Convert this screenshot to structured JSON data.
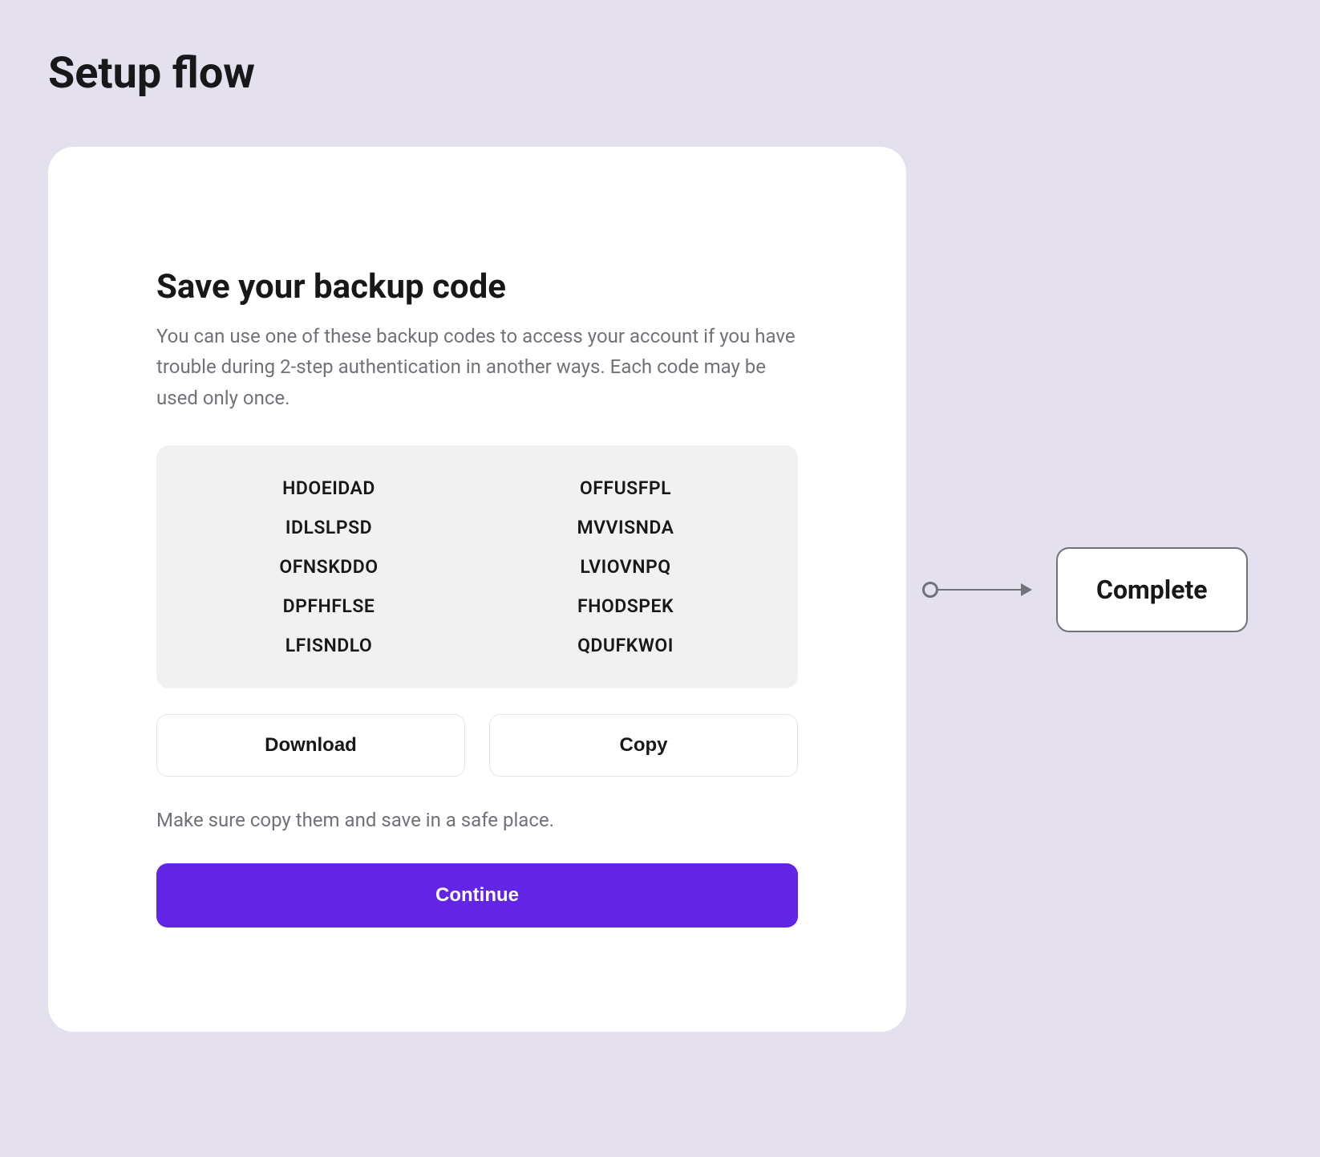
{
  "page": {
    "title": "Setup flow"
  },
  "card": {
    "title": "Save your backup code",
    "description": "You can use one of these backup codes to access your account if you have trouble during 2-step authentication in another ways. Each code may be used only once.",
    "codes": [
      "HDOEIDAD",
      "OFFUSFPL",
      "IDLSLPSD",
      "MVVISNDA",
      "OFNSKDDO",
      "LVIOVNPQ",
      "DPFHFLSE",
      "FHODSPEK",
      "LFISNDLO",
      "QDUFKWOI"
    ],
    "download_label": "Download",
    "copy_label": "Copy",
    "helper_text": "Make sure copy them and save in a safe place.",
    "continue_label": "Continue"
  },
  "flow": {
    "next_step_label": "Complete"
  },
  "colors": {
    "background": "#e4e0ee",
    "card_bg": "#ffffff",
    "text_primary": "#18181b",
    "text_secondary": "#71717a",
    "codes_bg": "#f1f1f2",
    "border": "#e4e4e7",
    "primary_button": "#6225e6"
  }
}
